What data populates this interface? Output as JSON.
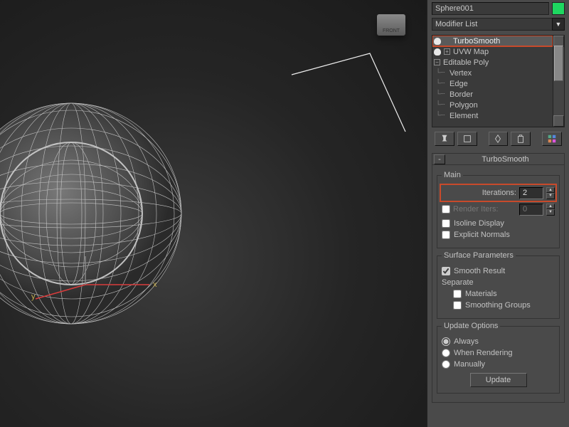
{
  "object_name": "Sphere001",
  "color_swatch": "#1ed760",
  "modifier_list_label": "Modifier List",
  "stack": {
    "items": [
      {
        "label": "TurboSmooth",
        "selected": true,
        "icon": "bulb",
        "expand": null,
        "level": 0
      },
      {
        "label": "UVW Map",
        "selected": false,
        "icon": "bulb",
        "expand": "plus",
        "level": 0
      },
      {
        "label": "Editable Poly",
        "selected": false,
        "icon": null,
        "expand": "minus",
        "level": 0
      },
      {
        "label": "Vertex",
        "selected": false,
        "icon": null,
        "expand": null,
        "level": 1
      },
      {
        "label": "Edge",
        "selected": false,
        "icon": null,
        "expand": null,
        "level": 1
      },
      {
        "label": "Border",
        "selected": false,
        "icon": null,
        "expand": null,
        "level": 1
      },
      {
        "label": "Polygon",
        "selected": false,
        "icon": null,
        "expand": null,
        "level": 1
      },
      {
        "label": "Element",
        "selected": false,
        "icon": null,
        "expand": null,
        "level": 1
      }
    ]
  },
  "toolbar_icons": [
    "pin",
    "stack-toggle",
    "sep",
    "subobj",
    "end-result",
    "sep",
    "configure"
  ],
  "rollup": {
    "title": "TurboSmooth",
    "main_legend": "Main",
    "iterations_label": "Iterations:",
    "iterations_value": "2",
    "render_iters_label": "Render Iters:",
    "render_iters_value": "0",
    "render_iters_checked": false,
    "isoline_label": "Isoline Display",
    "isoline_checked": false,
    "explicit_normals_label": "Explicit Normals",
    "explicit_normals_checked": false,
    "surface_legend": "Surface Parameters",
    "smooth_result_label": "Smooth Result",
    "smooth_result_checked": true,
    "separate_label": "Separate by:",
    "materials_label": "Materials",
    "materials_checked": false,
    "smoothing_groups_label": "Smoothing Groups",
    "smoothing_groups_checked": false,
    "update_legend": "Update Options",
    "update_opts": [
      {
        "label": "Always",
        "checked": true
      },
      {
        "label": "When Rendering",
        "checked": false
      },
      {
        "label": "Manually",
        "checked": false
      }
    ],
    "update_button": "Update"
  },
  "viewcube_face": "FRONT",
  "axes": {
    "x": "x",
    "y": "y"
  }
}
